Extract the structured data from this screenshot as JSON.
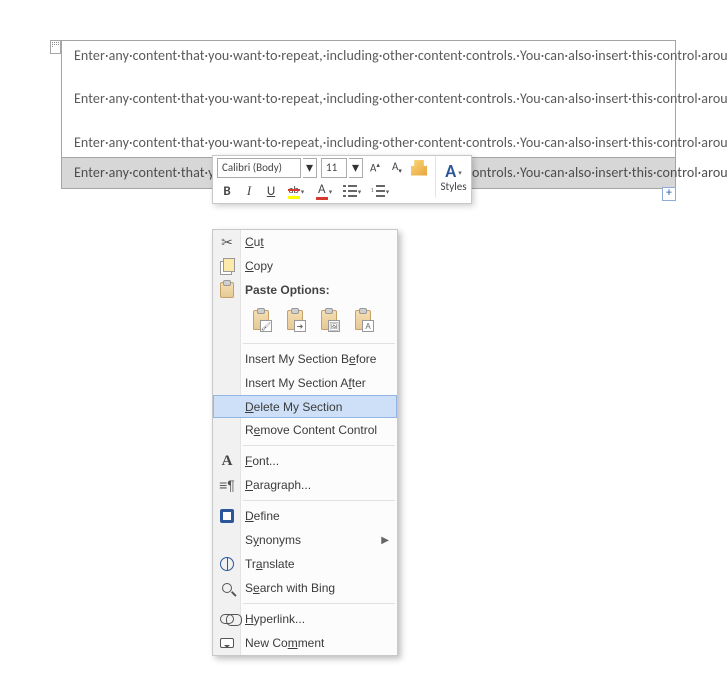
{
  "document": {
    "paragraph_text": "Enter·any·content·that·you·want·to·repeat,·including·other·content·controls.·You·can·also·insert·this·control·around·table·rows·in·order·to·repeat·parts·of·a·table.¶",
    "add_symbol": "+"
  },
  "mini_toolbar": {
    "font_name": "Calibri (Body)",
    "font_size": "11",
    "styles_label": "Styles"
  },
  "context_menu": {
    "cut": "Cut",
    "copy": "Copy",
    "paste_options": "Paste Options:",
    "insert_before": "Insert My Section Before",
    "insert_after": "Insert My Section After",
    "delete_section": "Delete My Section",
    "remove_cc": "Remove Content Control",
    "font": "Font...",
    "paragraph": "Paragraph...",
    "define": "Define",
    "synonyms": "Synonyms",
    "translate": "Translate",
    "search_bing": "Search with Bing",
    "hyperlink": "Hyperlink...",
    "new_comment": "New Comment"
  }
}
